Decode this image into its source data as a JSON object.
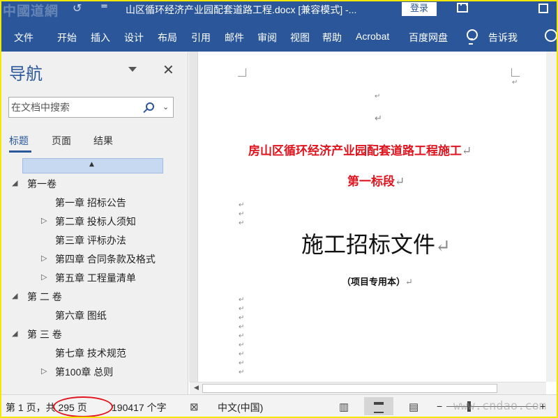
{
  "titlebar": {
    "watermark": "中國道網",
    "qat_more": "=",
    "title": "山区循环经济产业园配套道路工程.docx [兼容模式]  -...",
    "login_label": "登录"
  },
  "ribbon": {
    "tabs": [
      "文件",
      "开始",
      "插入",
      "设计",
      "布局",
      "引用",
      "邮件",
      "审阅",
      "视图",
      "帮助",
      "Acrobat",
      "百度网盘"
    ],
    "tell_me": "告诉我"
  },
  "nav": {
    "title": "导航",
    "search_placeholder": "在文档中搜索",
    "tabs": [
      "标题",
      "页面",
      "结果"
    ],
    "active_tab": "标题",
    "tree": [
      {
        "label": "第一卷",
        "level": 0,
        "expanded": true
      },
      {
        "label": "第一章 招标公告",
        "level": 1
      },
      {
        "label": "第二章 投标人须知",
        "level": 1,
        "collapsed": true
      },
      {
        "label": "第三章 评标办法",
        "level": 1
      },
      {
        "label": "第四章 合同条款及格式",
        "level": 1,
        "collapsed": true
      },
      {
        "label": "第五章 工程量清单",
        "level": 1,
        "collapsed": true
      },
      {
        "label": "第 二 卷",
        "level": 0,
        "expanded": true
      },
      {
        "label": "第六章 图纸",
        "level": 1
      },
      {
        "label": "第 三 卷",
        "level": 0,
        "expanded": true
      },
      {
        "label": "第七章 技术规范",
        "level": 1
      },
      {
        "label": "第100章 总则",
        "level": 1,
        "collapsed": true
      }
    ]
  },
  "document": {
    "title_line1": "房山区循环经济产业园配套道路工程施工",
    "title_line2": "第一标段",
    "main_title": "施工招标文件",
    "subtitle": "（项目专用本）",
    "paragraph_mark": "↵"
  },
  "statusbar": {
    "page_info": "第 1 页，共 295 页",
    "word_count": "190417 个字",
    "language": "中文(中国)",
    "zoom_minus": "−",
    "zoom_plus": "+",
    "watermark": "www.cndao.com"
  },
  "colors": {
    "accent": "#2b579a",
    "heading_red": "#e0141e",
    "frame_yellow": "#f2e800",
    "annotation_red": "#e0141e"
  }
}
